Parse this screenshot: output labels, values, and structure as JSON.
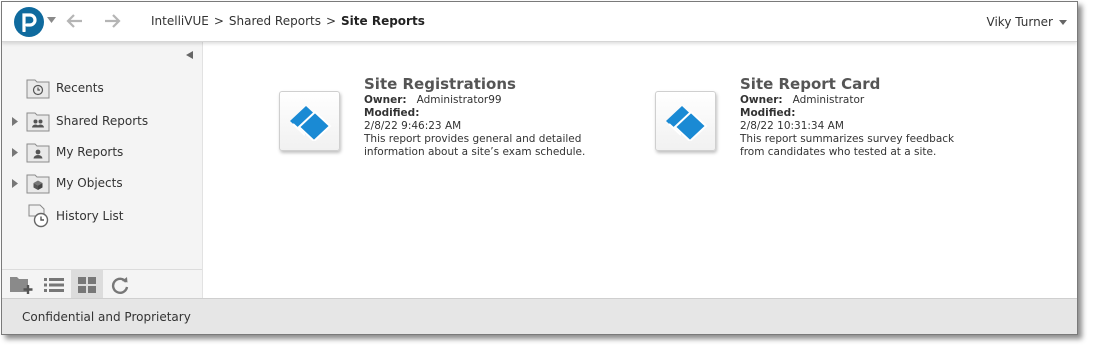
{
  "header": {
    "breadcrumb": [
      "IntelliVUE",
      "Shared Reports",
      "Site Reports"
    ],
    "separator": ">",
    "user_name": "Viky Turner"
  },
  "sidebar": {
    "items": [
      {
        "label": "Recents",
        "icon": "recents-folder-icon",
        "expandable": false
      },
      {
        "label": "Shared Reports",
        "icon": "shared-folder-icon",
        "expandable": true
      },
      {
        "label": "My Reports",
        "icon": "my-reports-folder-icon",
        "expandable": true
      },
      {
        "label": "My Objects",
        "icon": "my-objects-folder-icon",
        "expandable": true
      },
      {
        "label": "History List",
        "icon": "history-list-icon",
        "expandable": false
      }
    ],
    "toolbar": [
      "new-folder-icon",
      "list-view-icon",
      "grid-view-icon",
      "refresh-icon"
    ]
  },
  "cards": [
    {
      "title": "Site Registrations",
      "owner_label": "Owner:",
      "owner": "Administrator99",
      "modified_label": "Modified:",
      "modified": "2/8/22 9:46:23 AM",
      "description": "This report provides general and detailed information about a site’s exam schedule."
    },
    {
      "title": "Site Report Card",
      "owner_label": "Owner:",
      "owner": "Administrator",
      "modified_label": "Modified:",
      "modified": "2/8/22 10:31:34 AM",
      "description": "This report summarizes survey feedback from candidates who tested at a site."
    }
  ],
  "footer": {
    "text": "Confidential and Proprietary"
  },
  "colors": {
    "brand": "#0f6a9e",
    "report_icon": "#1a8ad4"
  }
}
